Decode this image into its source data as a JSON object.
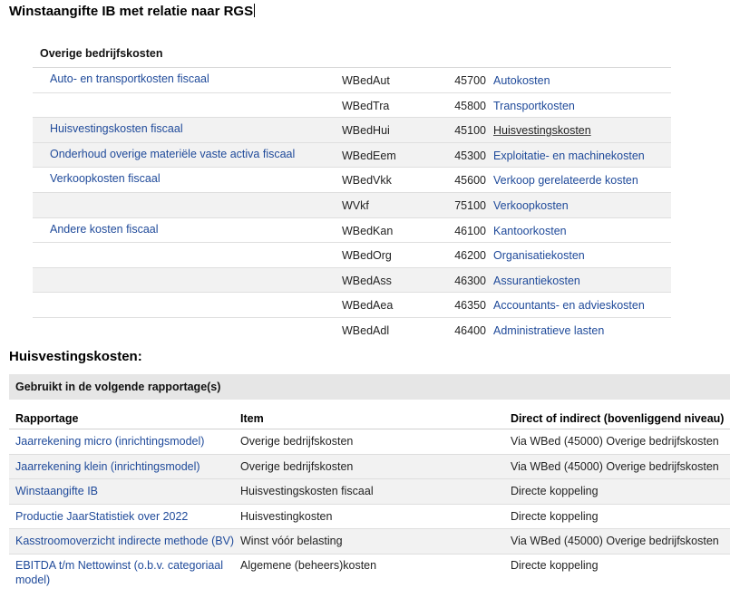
{
  "title": "Winstaangifte IB met relatie naar RGS",
  "rgs": {
    "header": "Overige bedrijfskosten",
    "rows": [
      {
        "category": "Auto- en transportkosten fiscaal",
        "code": "WBedAut",
        "number": "45700",
        "desc": "Autokosten"
      },
      {
        "category": "",
        "code": "WBedTra",
        "number": "45800",
        "desc": "Transportkosten"
      },
      {
        "category": "Huisvestingskosten fiscaal",
        "code": "WBedHui",
        "number": "45100",
        "desc": "Huisvestingskosten"
      },
      {
        "category": "Onderhoud overige materiële vaste activa fiscaal",
        "code": "WBedEem",
        "number": "45300",
        "desc": "Exploitatie- en machinekosten"
      },
      {
        "category": "Verkoopkosten fiscaal",
        "code": "WBedVkk",
        "number": "45600",
        "desc": "Verkoop gerelateerde kosten"
      },
      {
        "category": "",
        "code": "WVkf",
        "number": "75100",
        "desc": "Verkoopkosten"
      },
      {
        "category": "Andere kosten fiscaal",
        "code": "WBedKan",
        "number": "46100",
        "desc": "Kantoorkosten"
      },
      {
        "category": "",
        "code": "WBedOrg",
        "number": "46200",
        "desc": "Organisatiekosten"
      },
      {
        "category": "",
        "code": "WBedAss",
        "number": "46300",
        "desc": "Assurantiekosten"
      },
      {
        "category": "",
        "code": "WBedAea",
        "number": "46350",
        "desc": "Accountants- en advieskosten"
      },
      {
        "category": "",
        "code": "WBedAdl",
        "number": "46400",
        "desc": "Administratieve lasten"
      }
    ]
  },
  "subtitle": "Huisvestingskosten:",
  "usage": {
    "bar_label": "Gebruikt in de volgende rapportage(s)",
    "columns": [
      "Rapportage",
      "Item",
      "Direct of indirect (bovenliggend niveau)"
    ],
    "rows": [
      {
        "report": "Jaarrekening micro (inrichtingsmodel)",
        "item": "Overige bedrijfskosten",
        "link": "Via WBed (45000) Overige bedrijfskosten"
      },
      {
        "report": "Jaarrekening klein (inrichtingsmodel)",
        "item": "Overige bedrijfskosten",
        "link": "Via WBed (45000) Overige bedrijfskosten"
      },
      {
        "report": "Winstaangifte IB",
        "item": "Huisvestingskosten fiscaal",
        "link": "Directe koppeling"
      },
      {
        "report": "Productie JaarStatistiek over 2022",
        "item": "Huisvestingkosten",
        "link": "Directe koppeling"
      },
      {
        "report": "Kasstroomoverzicht indirecte methode (BV)",
        "item": "Winst vóór belasting",
        "link": "Via WBed (45000) Overige bedrijfskosten"
      },
      {
        "report": "EBITDA t/m Nettowinst (o.b.v. categoriaal model)",
        "item": "Algemene (beheers)kosten",
        "link": "Directe koppeling"
      }
    ]
  },
  "colors": {
    "link": "#1f4a9a",
    "alt_row": "#f2f2f2",
    "bar": "#e6e6e6"
  }
}
